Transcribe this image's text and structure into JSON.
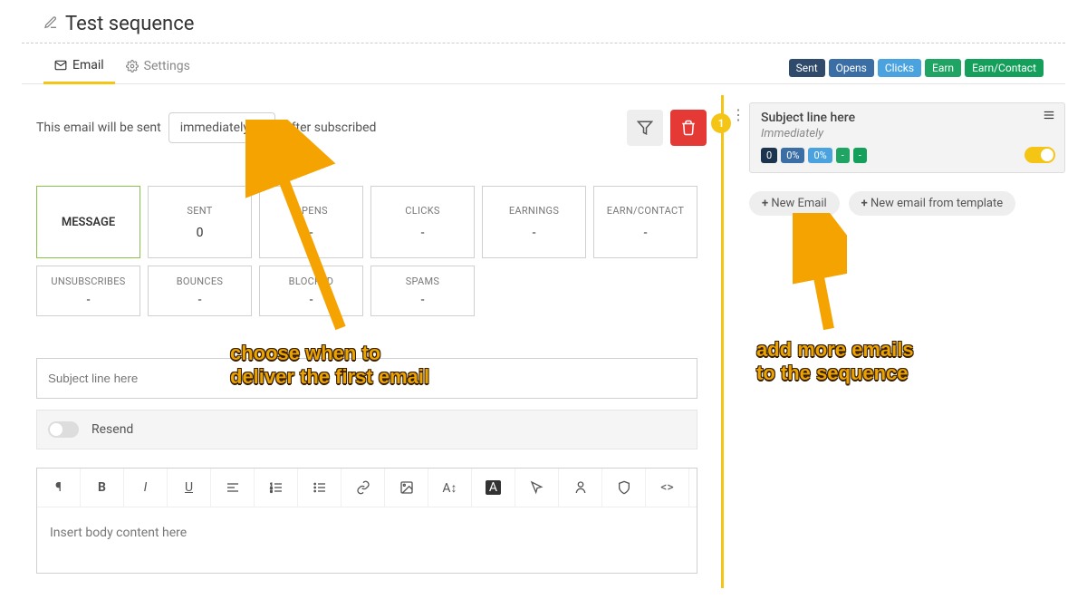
{
  "page_title": "Test sequence",
  "tabs": {
    "email": "Email",
    "settings": "Settings"
  },
  "header_pills": [
    "Sent",
    "Opens",
    "Clicks",
    "Earn",
    "Earn/Contact"
  ],
  "schedule": {
    "lead": "This email will be sent",
    "select": "immediately",
    "trail": "after subscribed"
  },
  "stats_row1": [
    {
      "label": "SENT",
      "val": "0"
    },
    {
      "label": "OPENS",
      "val": "-"
    },
    {
      "label": "CLICKS",
      "val": "-"
    },
    {
      "label": "EARNINGS",
      "val": "-"
    },
    {
      "label": "EARN/CONTACT",
      "val": "-"
    }
  ],
  "stats_row2": [
    {
      "label": "UNSUBSCRIBES",
      "val": "-"
    },
    {
      "label": "BOUNCES",
      "val": "-"
    },
    {
      "label": "BLOCKED",
      "val": "-"
    },
    {
      "label": "SPAMS",
      "val": "-"
    }
  ],
  "message_card": "MESSAGE",
  "subject_placeholder": "Subject line here",
  "resend_label": "Resend",
  "body_placeholder": "Insert body content here",
  "step_badge": "1",
  "card": {
    "subject": "Subject line here",
    "when": "Immediately",
    "chips": [
      "0",
      "0%",
      "0%",
      "-",
      "-"
    ]
  },
  "add": {
    "new_email": "New Email",
    "new_template": "New email from template"
  },
  "annotations": {
    "a1": "choose when to\ndeliver the first email",
    "a2": "add more emails\nto the sequence"
  }
}
